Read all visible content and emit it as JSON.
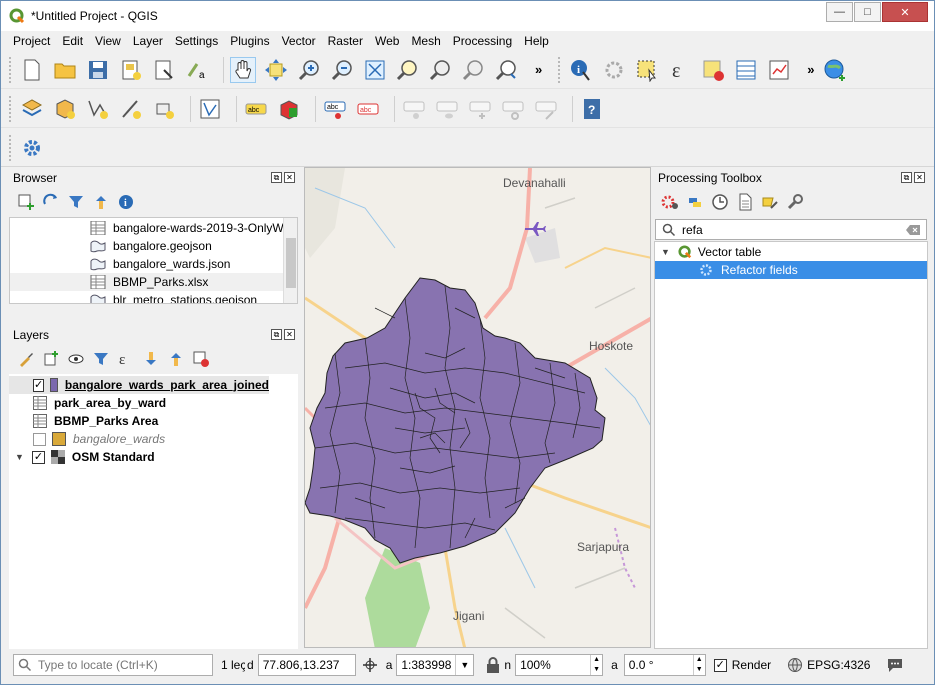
{
  "window": {
    "title": "*Untitled Project - QGIS",
    "buttons": {
      "minimize": "—",
      "maximize": "□",
      "close": "✕"
    }
  },
  "menu": [
    "Project",
    "Edit",
    "View",
    "Layer",
    "Settings",
    "Plugins",
    "Vector",
    "Raster",
    "Web",
    "Mesh",
    "Processing",
    "Help"
  ],
  "toolbars": {
    "overflow": "»",
    "label_tool_text": "abc"
  },
  "browser": {
    "title": "Browser",
    "items": [
      {
        "label": "bangalore-wards-2019-3-OnlyW",
        "icon": "table-icon"
      },
      {
        "label": "bangalore.geojson",
        "icon": "vector-polygon-icon"
      },
      {
        "label": "bangalore_wards.json",
        "icon": "vector-polygon-icon"
      },
      {
        "label": "BBMP_Parks.xlsx",
        "icon": "table-icon"
      },
      {
        "label": "blr_metro_stations.geojson",
        "icon": "vector-polygon-icon"
      }
    ]
  },
  "layers": {
    "title": "Layers",
    "items": [
      {
        "label": "bangalore_wards_park_area_joined",
        "checked": true,
        "color": "#7b68ae"
      },
      {
        "label": "park_area_by_ward",
        "checked": null,
        "color": null
      },
      {
        "label": "BBMP_Parks Area",
        "checked": null,
        "color": null
      },
      {
        "label": "bangalore_wards",
        "checked": false,
        "color": "#d9a93a"
      },
      {
        "label": "OSM Standard",
        "checked": true,
        "color": null
      }
    ],
    "check_mark": "✓"
  },
  "map": {
    "places": [
      "Devanahalli",
      "Hoskote",
      "Sarjapura",
      "Jigani"
    ],
    "polygon_color": "#8873b0"
  },
  "processing": {
    "title": "Processing Toolbox",
    "search_value": "refa",
    "group": "Vector table",
    "algorithm": "Refactor fields",
    "selected_color": "#3a8ee6"
  },
  "status": {
    "locate_placeholder": "Type to locate (Ctrl+K)",
    "legend_msg": "1 leç",
    "coord_label": "d",
    "coordinate": "77.806,13.237",
    "scale_label": "a",
    "scale": "1:383998",
    "magnifier_label": "n",
    "magnifier": "100%",
    "rotation_label": "a",
    "rotation": "0.0 °",
    "render_label": "Render",
    "render_checked": true,
    "crs": "EPSG:4326"
  }
}
